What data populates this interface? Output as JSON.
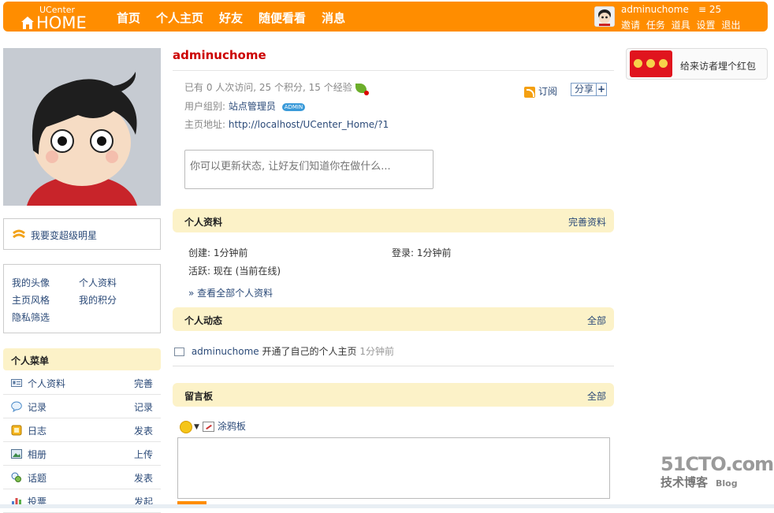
{
  "topbar": {
    "logo_small": "UCenter",
    "logo_big": "HOME",
    "nav": [
      "首页",
      "个人主页",
      "好友",
      "随便看看",
      "消息"
    ],
    "username": "adminuchome",
    "coin_count": "25",
    "user_links": [
      "邀请",
      "任务",
      "道具",
      "设置",
      "退出"
    ]
  },
  "sidebar": {
    "star_text": "我要变超级明星",
    "quick_links": [
      "我的头像",
      "个人资料",
      "主页风格",
      "我的积分",
      "隐私筛选"
    ],
    "menu_title": "个人菜单",
    "menu": [
      {
        "label": "个人资料",
        "action": "完善",
        "icon": "card-icon"
      },
      {
        "label": "记录",
        "action": "记录",
        "icon": "speech-bubble-icon"
      },
      {
        "label": "日志",
        "action": "发表",
        "icon": "notebook-icon"
      },
      {
        "label": "相册",
        "action": "上传",
        "icon": "photo-icon"
      },
      {
        "label": "话题",
        "action": "发表",
        "icon": "topic-icon"
      },
      {
        "label": "投票",
        "action": "发起",
        "icon": "bar-chart-icon"
      }
    ]
  },
  "profile": {
    "name": "adminuchome",
    "stats": "已有 0 人次访问, 25 个积分, 15 个经验",
    "group_label": "用户组别:",
    "group_value": "站点管理员",
    "group_badge": "ADMIN",
    "url_label": "主页地址:",
    "url_value": "http://localhost/UCenter_Home/?1",
    "subscribe": "订阅",
    "share": "分享",
    "share_plus": "+",
    "status_placeholder": "你可以更新状态, 让好友们知道你在做什么..."
  },
  "info_section": {
    "title": "个人资料",
    "action": "完善资料",
    "created": "创建: 1分钟前",
    "login": "登录: 1分钟前",
    "active": "活跃: 现在 (当前在线)",
    "more": "» 查看全部个人资料"
  },
  "feed_section": {
    "title": "个人动态",
    "action": "全部",
    "item_user": "adminuchome",
    "item_text": "开通了自己的个人主页",
    "item_time": "1分钟前"
  },
  "board_section": {
    "title": "留言板",
    "action": "全部",
    "doodle": "涂鸦板"
  },
  "right": {
    "redpack_text": "给来访者埋个红包"
  },
  "watermark": {
    "big": "51CTO.com",
    "small": "技术博客",
    "blog": "Blog"
  },
  "colors": {
    "brand": "#ff8d00",
    "section_bg": "#fcf2c8",
    "link": "#2b4a78",
    "title_red": "#cc0000"
  }
}
